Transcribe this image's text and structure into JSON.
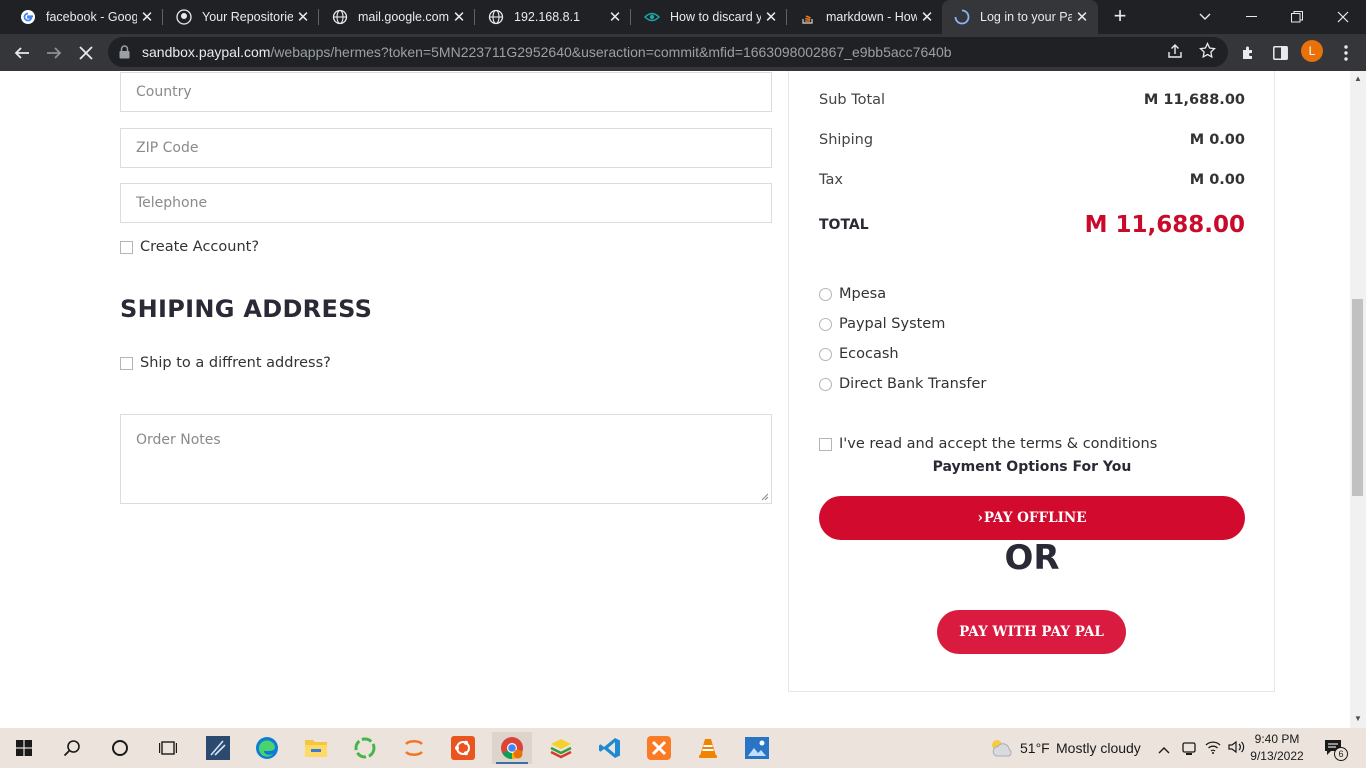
{
  "browser": {
    "tabs": [
      {
        "title": "facebook - Googl",
        "icon": "google-icon"
      },
      {
        "title": "Your Repositories",
        "icon": "github-icon"
      },
      {
        "title": "mail.google.com",
        "icon": "globe-icon"
      },
      {
        "title": "192.168.8.1",
        "icon": "globe-icon"
      },
      {
        "title": "How to discard y",
        "icon": "eye-icon"
      },
      {
        "title": "markdown - How",
        "icon": "stackoverflow-icon"
      },
      {
        "title": "Log in to your Pa",
        "icon": "loading-spinner-icon"
      }
    ],
    "new_tab": "+",
    "url_domain": "sandbox.paypal.com",
    "url_path": "/webapps/hermes?token=5MN223711G2952640&useraction=commit&mfid=1663098002867_e9bb5acc7640b",
    "profile_initial": "L"
  },
  "form": {
    "country_placeholder": "Country",
    "zip_placeholder": "ZIP Code",
    "telephone_placeholder": "Telephone",
    "create_account_label": "Create Account?",
    "shipping_heading": "SHIPING ADDRESS",
    "ship_different_label": "Ship to a diffrent address?",
    "order_notes_placeholder": "Order Notes"
  },
  "summary": {
    "subtotal_label": "Sub Total",
    "subtotal_value": "M 11,688.00",
    "shipping_label": "Shiping",
    "shipping_value": "M 0.00",
    "tax_label": "Tax",
    "tax_value": "M 0.00",
    "total_label": "TOTAL",
    "total_value": "M 11,688.00",
    "payment_methods": [
      "Mpesa",
      "Paypal System",
      "Ecocash",
      "Direct Bank Transfer"
    ],
    "terms_label": "I've read and accept the terms & conditions",
    "payment_options_title": "Payment Options For You",
    "pay_offline_label": "PAY OFFLINE",
    "or_label": "OR",
    "pay_paypal_label": "PAY WITH PAY PAL",
    "accent_color": "#d10a2e"
  },
  "taskbar": {
    "weather_temp": "51°F",
    "weather_text": "Mostly cloudy",
    "time": "9:40 PM",
    "date": "9/13/2022",
    "notification_count": "6"
  }
}
